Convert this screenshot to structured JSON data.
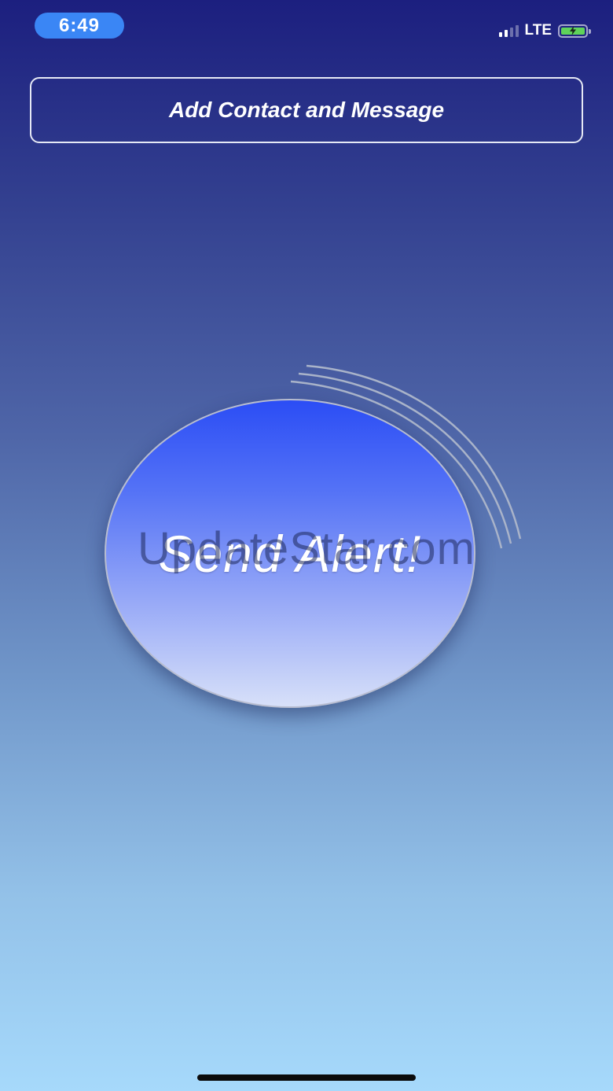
{
  "status_bar": {
    "time": "6:49",
    "network": "LTE",
    "signal_bars_active": 2,
    "signal_bars_total": 4,
    "battery_level": 1.0,
    "battery_color": "#5fd35a",
    "charging": true
  },
  "main": {
    "add_contact_label": "Add Contact and Message",
    "send_alert_label": "Send Alert!"
  },
  "overlay": {
    "watermark": "UpdateStar.com"
  },
  "colors": {
    "background_top": "#1c1f7f",
    "background_bottom": "#a6d9fb",
    "send_button_top": "#2b4df5",
    "send_button_bottom": "#d7e0f9",
    "time_pill": "#3a86f5"
  },
  "icons": {
    "signal": "cellular-signal-icon",
    "battery": "battery-charging-icon",
    "waves": "broadcast-waves-icon"
  }
}
